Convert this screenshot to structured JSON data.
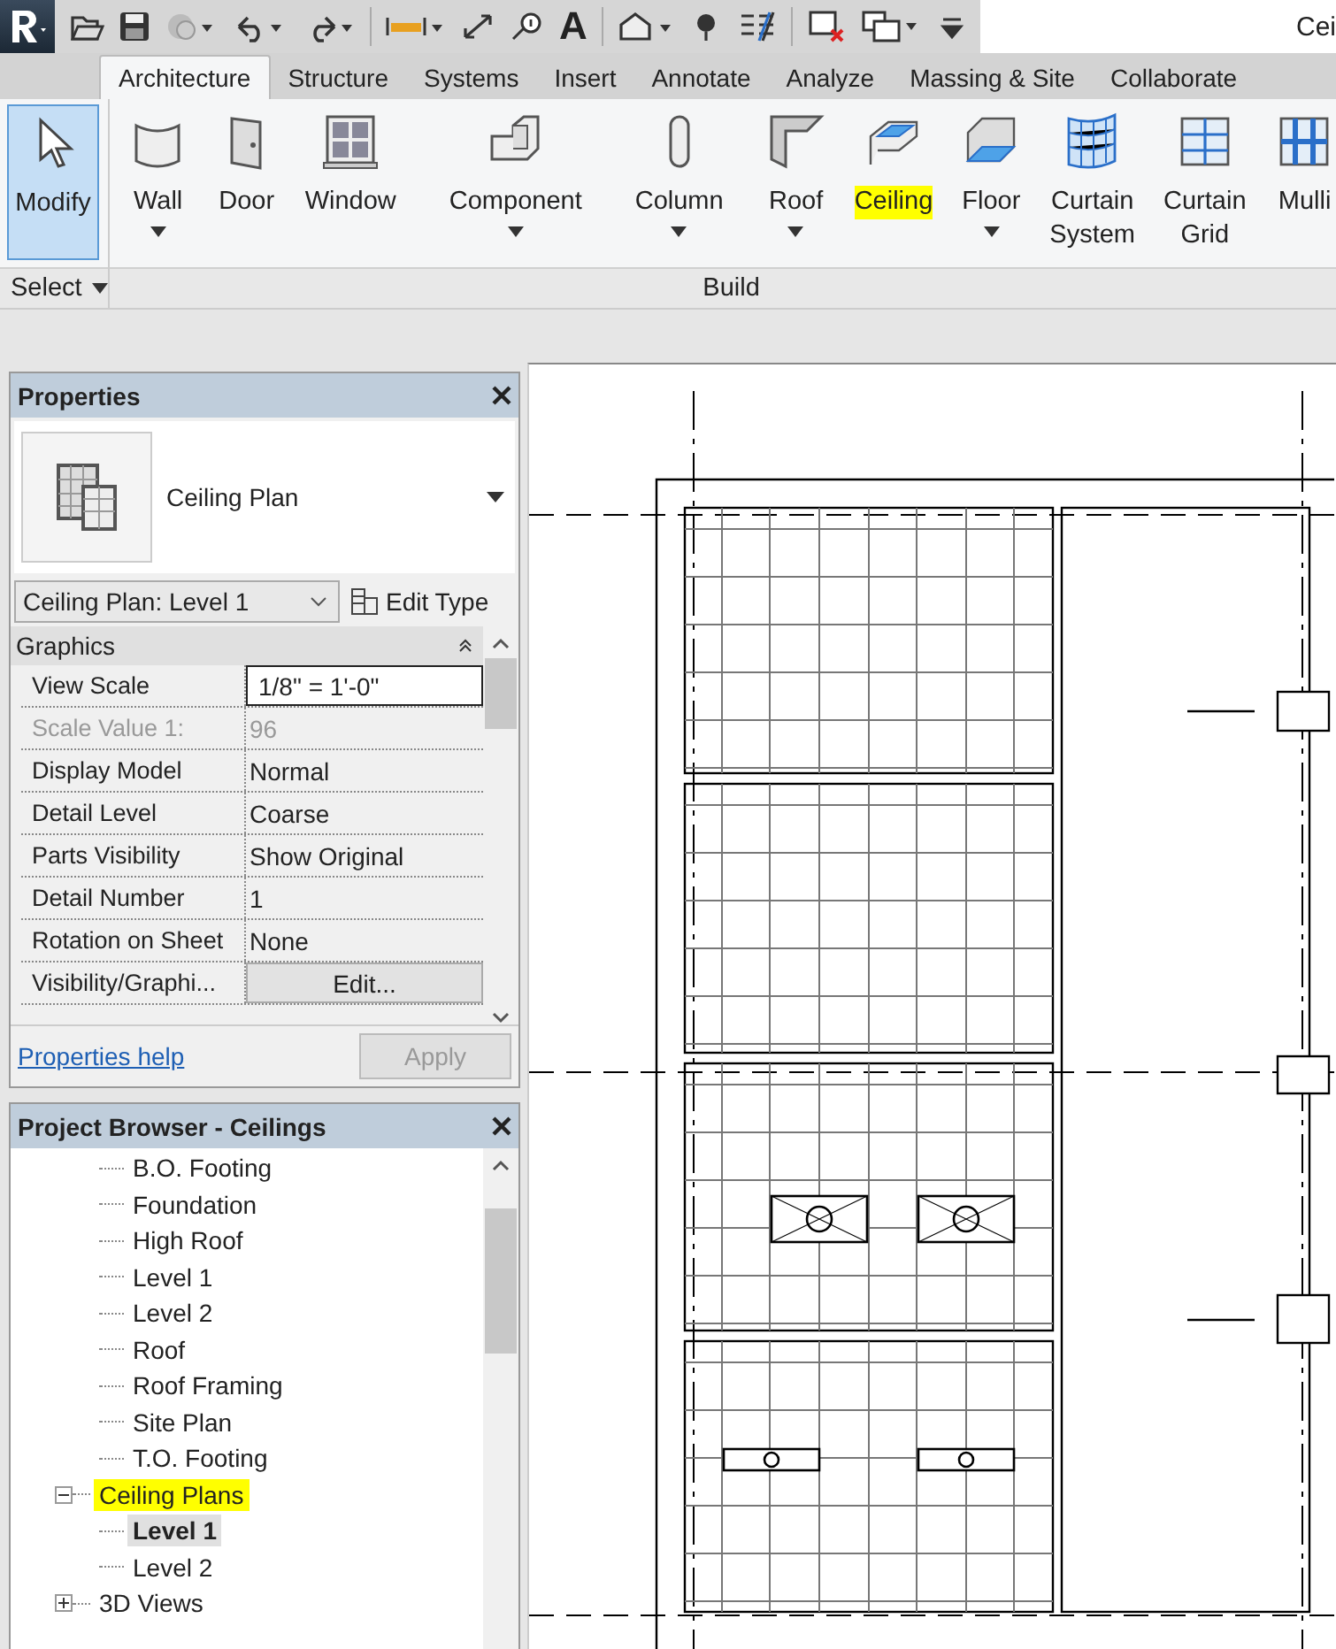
{
  "window": {
    "title": "Cei"
  },
  "quick_access": {
    "text_glyph": "A"
  },
  "tabs": [
    {
      "label": "Architecture",
      "selected": true
    },
    {
      "label": "Structure",
      "selected": false
    },
    {
      "label": "Systems",
      "selected": false
    },
    {
      "label": "Insert",
      "selected": false
    },
    {
      "label": "Annotate",
      "selected": false
    },
    {
      "label": "Analyze",
      "selected": false
    },
    {
      "label": "Massing & Site",
      "selected": false
    },
    {
      "label": "Collaborate",
      "selected": false
    }
  ],
  "ribbon": {
    "panels": [
      {
        "label": "Select",
        "has_dropdown": true,
        "tools": [
          {
            "kind": "modify",
            "lines": [
              "Modify"
            ],
            "selected": true,
            "highlighted": false,
            "has_dropdown": false
          }
        ]
      },
      {
        "label": "Build",
        "has_dropdown": false,
        "tools": [
          {
            "kind": "wall",
            "lines": [
              "Wall"
            ],
            "selected": false,
            "highlighted": false,
            "has_dropdown": true
          },
          {
            "kind": "door",
            "lines": [
              "Door"
            ],
            "selected": false,
            "highlighted": false,
            "has_dropdown": false
          },
          {
            "kind": "window",
            "lines": [
              "Window"
            ],
            "selected": false,
            "highlighted": false,
            "has_dropdown": false
          },
          {
            "kind": "component",
            "lines": [
              "Component"
            ],
            "selected": false,
            "highlighted": false,
            "has_dropdown": true
          },
          {
            "kind": "column",
            "lines": [
              "Column"
            ],
            "selected": false,
            "highlighted": false,
            "has_dropdown": true
          },
          {
            "kind": "roof",
            "lines": [
              "Roof"
            ],
            "selected": false,
            "highlighted": false,
            "has_dropdown": true
          },
          {
            "kind": "ceiling",
            "lines": [
              "Ceiling"
            ],
            "selected": false,
            "highlighted": true,
            "has_dropdown": false
          },
          {
            "kind": "floor",
            "lines": [
              "Floor"
            ],
            "selected": false,
            "highlighted": false,
            "has_dropdown": true
          },
          {
            "kind": "curtain_system",
            "lines": [
              "Curtain",
              "System"
            ],
            "selected": false,
            "highlighted": false,
            "has_dropdown": false
          },
          {
            "kind": "curtain_grid",
            "lines": [
              "Curtain",
              "Grid"
            ],
            "selected": false,
            "highlighted": false,
            "has_dropdown": false
          },
          {
            "kind": "mullion",
            "lines": [
              "Mulli"
            ],
            "selected": false,
            "highlighted": false,
            "has_dropdown": false
          }
        ]
      }
    ]
  },
  "properties": {
    "title": "Properties",
    "type_name": "Ceiling Plan",
    "instance": "Ceiling Plan: Level 1",
    "edit_type": "Edit Type",
    "section": "Graphics",
    "rows": [
      {
        "name": "View Scale",
        "value": "1/8\" = 1'-0\"",
        "kind": "input",
        "disabled": false
      },
      {
        "name": "Scale Value    1:",
        "value": "96",
        "kind": "text",
        "disabled": true
      },
      {
        "name": "Display Model",
        "value": "Normal",
        "kind": "text",
        "disabled": false
      },
      {
        "name": "Detail Level",
        "value": "Coarse",
        "kind": "text",
        "disabled": false
      },
      {
        "name": "Parts Visibility",
        "value": "Show Original",
        "kind": "text",
        "disabled": false
      },
      {
        "name": "Detail Number",
        "value": "1",
        "kind": "text",
        "disabled": false
      },
      {
        "name": "Rotation on Sheet",
        "value": "None",
        "kind": "text",
        "disabled": false
      },
      {
        "name": "Visibility/Graphi...",
        "value": "Edit...",
        "kind": "button",
        "disabled": false
      }
    ],
    "help": "Properties help",
    "apply": {
      "label": "Apply",
      "disabled": true
    }
  },
  "project_browser": {
    "title": "Project Browser - Ceilings",
    "nodes": [
      {
        "children": [
          {
            "label": "B.O. Footing",
            "selected": false
          },
          {
            "label": "Foundation",
            "selected": false
          },
          {
            "label": "High Roof",
            "selected": false
          },
          {
            "label": "Level 1",
            "selected": false
          },
          {
            "label": "Level 2",
            "selected": false
          },
          {
            "label": "Roof",
            "selected": false
          },
          {
            "label": "Roof Framing",
            "selected": false
          },
          {
            "label": "Site Plan",
            "selected": false
          },
          {
            "label": "T.O. Footing",
            "selected": false
          }
        ]
      },
      {
        "label": "Ceiling Plans",
        "expanded": true,
        "highlighted": true,
        "children": [
          {
            "label": "Level 1",
            "selected": true
          },
          {
            "label": "Level 2",
            "selected": false
          }
        ]
      },
      {
        "label": "3D Views",
        "expanded": false,
        "highlighted": false
      }
    ]
  }
}
